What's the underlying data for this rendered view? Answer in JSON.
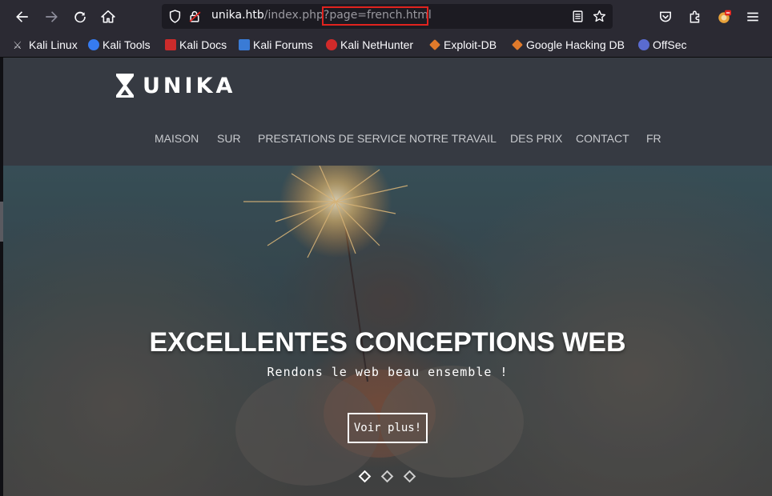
{
  "browser": {
    "url_host": "unika.htb",
    "url_path": "/index.php",
    "url_query": "?page=french.html",
    "icons": [
      "back-icon",
      "forward-icon",
      "reload-icon",
      "home-icon",
      "shield-icon",
      "lock-icon",
      "reader-icon",
      "star-icon",
      "pocket-icon",
      "extensions-icon",
      "profile-icon",
      "menu-icon"
    ]
  },
  "bookmarks": [
    {
      "label": "Kali Linux",
      "color": "#367bf0"
    },
    {
      "label": "Kali Tools",
      "color": "#e05a2b"
    },
    {
      "label": "Kali Docs",
      "color": "#cc2b2b"
    },
    {
      "label": "Kali Forums",
      "color": "#3a7bd5"
    },
    {
      "label": "Kali NetHunter",
      "color": "#d12a2a"
    },
    {
      "label": "Exploit-DB",
      "color": "#e07a2b"
    },
    {
      "label": "Google Hacking DB",
      "color": "#e07a2b"
    },
    {
      "label": "OffSec",
      "color": "#5a6bd0"
    }
  ],
  "site": {
    "logo_text": "UNIKA",
    "nav": [
      "MAISON",
      "SUR",
      "PRESTATIONS DE SERVICE",
      "NOTRE TRAVAIL",
      "DES PRIX",
      "CONTACT",
      "FR"
    ],
    "hero_title": "EXCELLENTES CONCEPTIONS WEB",
    "hero_subtitle": "Rendons le web beau ensemble !",
    "hero_button": "Voir plus!",
    "slides": 3,
    "active_slide": 1
  },
  "colors": {
    "toolbar_bg": "#2b2a33",
    "url_highlight": "#e0231e",
    "header_bg": "#363a42",
    "nav_text": "#c7c9cd"
  }
}
